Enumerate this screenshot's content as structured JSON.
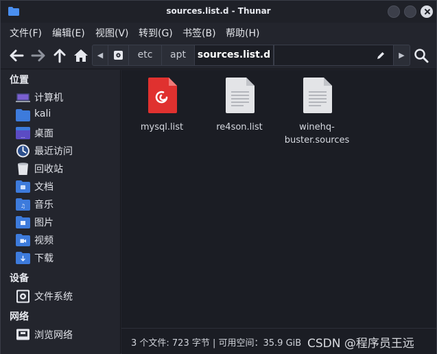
{
  "window": {
    "title": "sources.list.d - Thunar"
  },
  "menubar": {
    "items": [
      "文件(F)",
      "编辑(E)",
      "视图(V)",
      "转到(G)",
      "书签(B)",
      "帮助(H)"
    ]
  },
  "toolbar": {
    "back_icon": "arrow-left-icon",
    "forward_icon": "arrow-right-icon",
    "up_icon": "arrow-up-icon",
    "home_icon": "home-icon",
    "search_icon": "search-icon"
  },
  "pathbar": {
    "crumbs": [
      "etc",
      "apt",
      "sources.list.d"
    ]
  },
  "sidebar": {
    "places_header": "位置",
    "places": [
      "计算机",
      "kali",
      "桌面",
      "最近访问",
      "回收站",
      "文档",
      "音乐",
      "图片",
      "视频",
      "下载"
    ],
    "devices_header": "设备",
    "devices": [
      "文件系统"
    ],
    "network_header": "网络",
    "network": [
      "浏览网络"
    ]
  },
  "files": [
    {
      "name": "mysql.list",
      "icon": "debian-red-file-icon"
    },
    {
      "name": "re4son.list",
      "icon": "text-file-icon"
    },
    {
      "name": "winehq-",
      "name2": "buster.sources",
      "icon": "text-file-icon"
    }
  ],
  "status": {
    "text": "3 个文件: 723 字节 | 可用空间：35.9 GiB"
  },
  "watermark": "CSDN @程序员王远",
  "colors": {
    "accent": "#3b82f6",
    "folder": "#3d7bdc",
    "red_file": "#e0312f"
  }
}
